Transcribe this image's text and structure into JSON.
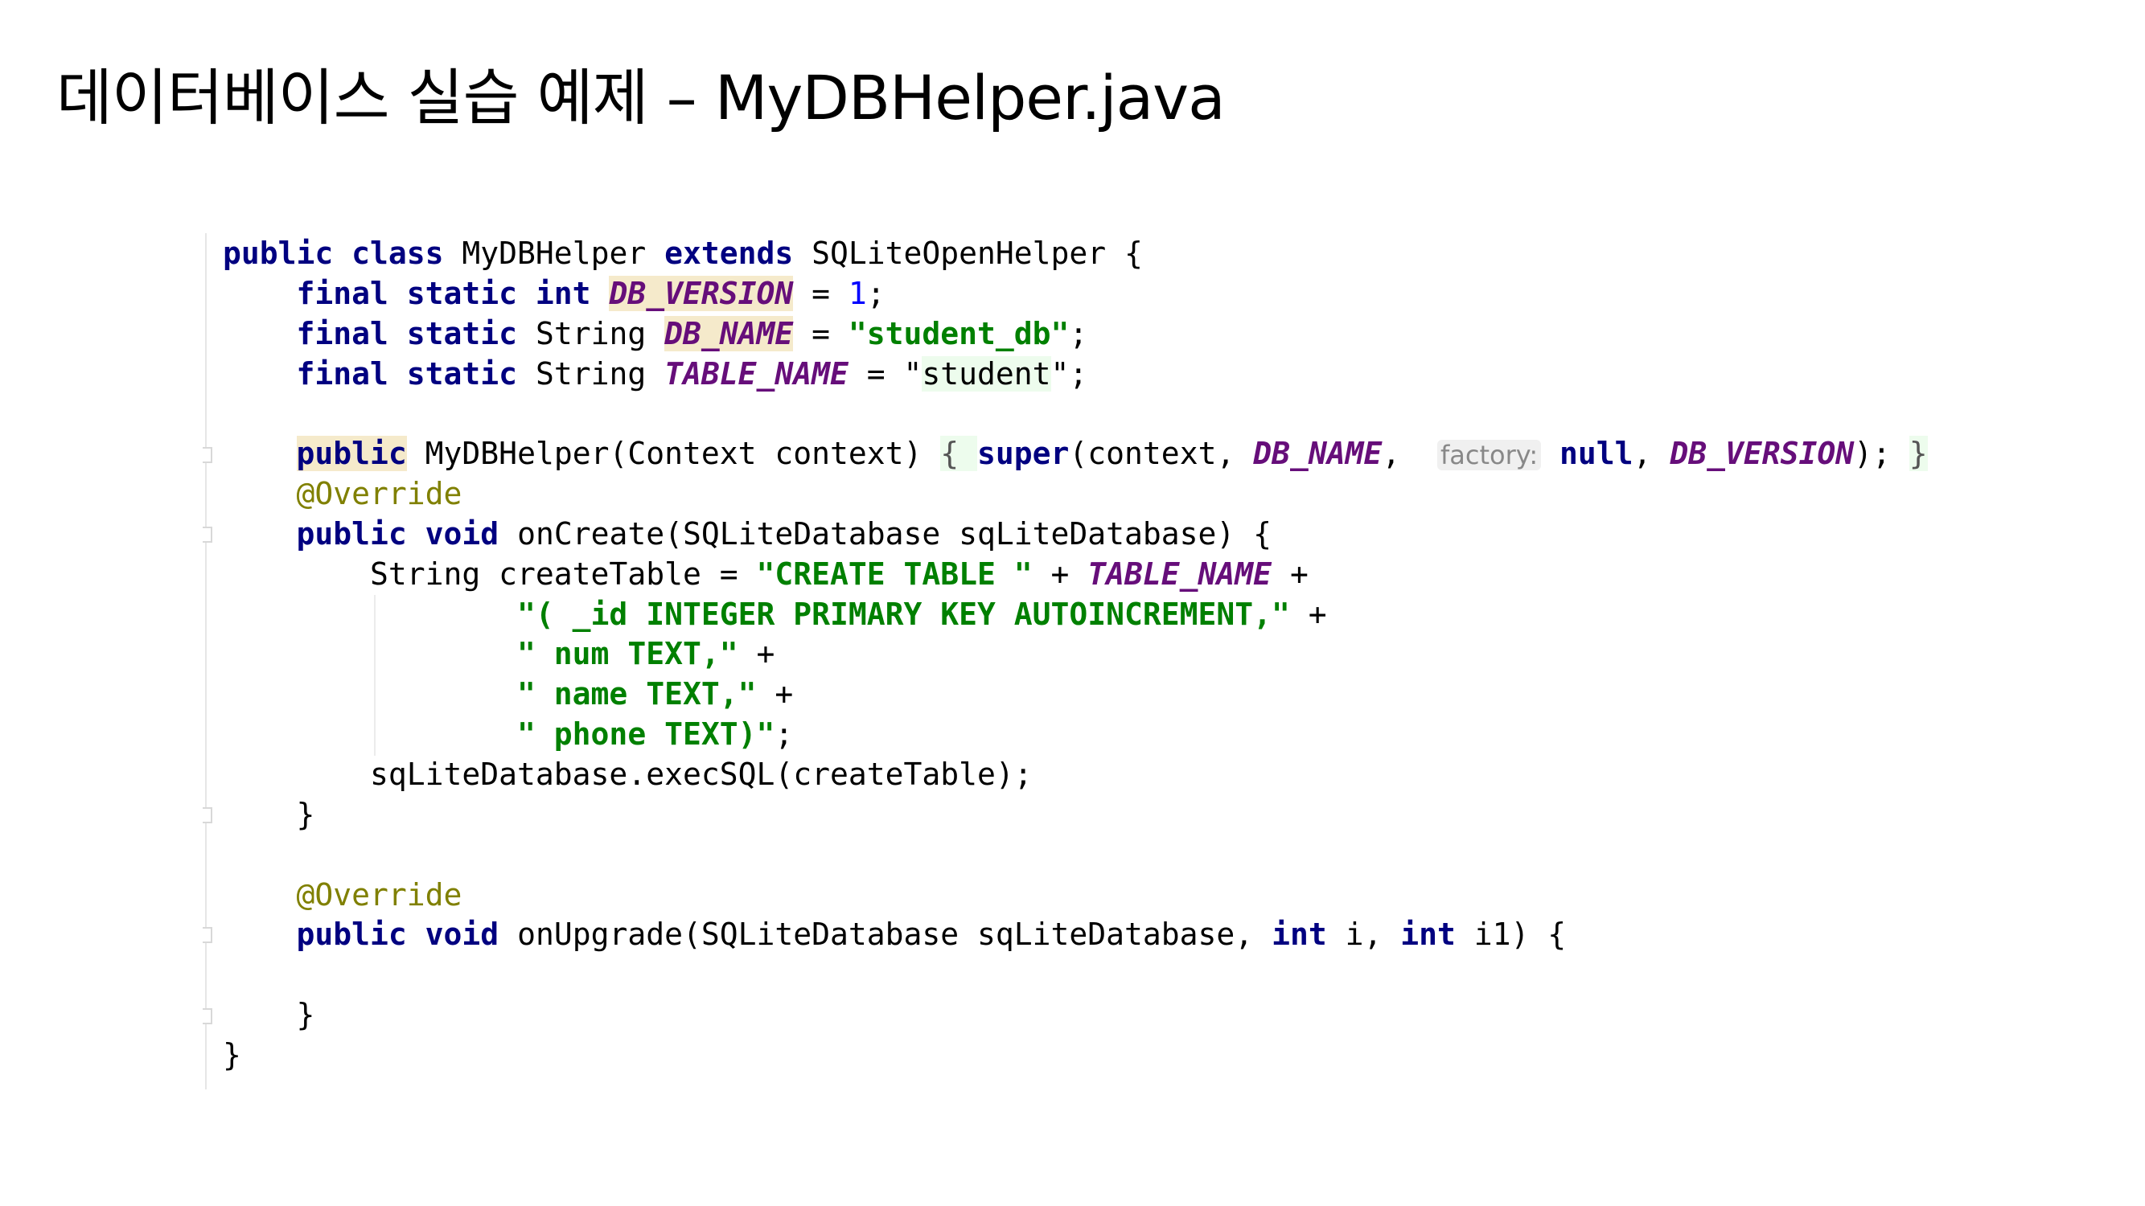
{
  "slide": {
    "title": "데이터베이스 실습 예제 – MyDBHelper.java"
  },
  "colors": {
    "keyword": "#000080",
    "constant": "#660E7A",
    "string": "#008000",
    "number": "#0000FF",
    "annotation": "#808000",
    "highlight_usage": "#F5EACB",
    "highlight_match": "#EDFCED"
  },
  "code": {
    "lines": [
      [
        {
          "t": "public class ",
          "c": "kw"
        },
        {
          "t": "MyDBHelper "
        },
        {
          "t": "extends ",
          "c": "kw"
        },
        {
          "t": "SQLiteOpenHelper {"
        }
      ],
      [
        {
          "t": "    "
        },
        {
          "t": "final static int ",
          "c": "kw"
        },
        {
          "t": "DB_VERSION",
          "c": "const hl-y"
        },
        {
          "t": " = "
        },
        {
          "t": "1",
          "c": "num"
        },
        {
          "t": ";"
        }
      ],
      [
        {
          "t": "    "
        },
        {
          "t": "final static ",
          "c": "kw"
        },
        {
          "t": "String "
        },
        {
          "t": "DB_NAME",
          "c": "const hl-y"
        },
        {
          "t": " = "
        },
        {
          "t": "\"student_db\"",
          "c": "str"
        },
        {
          "t": ";"
        }
      ],
      [
        {
          "t": "    "
        },
        {
          "t": "final static ",
          "c": "kw"
        },
        {
          "t": "String "
        },
        {
          "t": "TABLE_NAME",
          "c": "const"
        },
        {
          "t": " = \""
        },
        {
          "t": "student",
          "c": "hl-g"
        },
        {
          "t": "\";"
        }
      ],
      [],
      [
        {
          "t": "    "
        },
        {
          "t": "public",
          "c": "kw hl-y"
        },
        {
          "t": " MyDBHelper(Context context) "
        },
        {
          "t": "{ ",
          "c": "brace hl-g"
        },
        {
          "t": "super",
          "c": "kw"
        },
        {
          "t": "(context, "
        },
        {
          "t": "DB_NAME",
          "c": "const"
        },
        {
          "t": ",  "
        },
        {
          "t": "factory:",
          "c": "hint"
        },
        {
          "t": " "
        },
        {
          "t": "null",
          "c": "kw"
        },
        {
          "t": ", "
        },
        {
          "t": "DB_VERSION",
          "c": "const"
        },
        {
          "t": "); "
        },
        {
          "t": "}",
          "c": "brace hl-g"
        }
      ],
      [
        {
          "t": "    "
        },
        {
          "t": "@Override",
          "c": "ann"
        }
      ],
      [
        {
          "t": "    "
        },
        {
          "t": "public void ",
          "c": "kw"
        },
        {
          "t": "onCreate(SQLiteDatabase sqLiteDatabase) {"
        }
      ],
      [
        {
          "t": "        String createTable = "
        },
        {
          "t": "\"CREATE TABLE \"",
          "c": "str"
        },
        {
          "t": " + "
        },
        {
          "t": "TABLE_NAME",
          "c": "const"
        },
        {
          "t": " +"
        }
      ],
      [
        {
          "t": "                "
        },
        {
          "t": "\"( _id INTEGER PRIMARY KEY AUTOINCREMENT,\"",
          "c": "str"
        },
        {
          "t": " +"
        }
      ],
      [
        {
          "t": "                "
        },
        {
          "t": "\" num TEXT,\"",
          "c": "str"
        },
        {
          "t": " +"
        }
      ],
      [
        {
          "t": "                "
        },
        {
          "t": "\" name TEXT,\"",
          "c": "str"
        },
        {
          "t": " +"
        }
      ],
      [
        {
          "t": "                "
        },
        {
          "t": "\" phone TEXT)\"",
          "c": "str"
        },
        {
          "t": ";"
        }
      ],
      [
        {
          "t": "        sqLiteDatabase.execSQL(createTable);"
        }
      ],
      [
        {
          "t": "    }"
        }
      ],
      [],
      [
        {
          "t": "    "
        },
        {
          "t": "@Override",
          "c": "ann"
        }
      ],
      [
        {
          "t": "    "
        },
        {
          "t": "public void ",
          "c": "kw"
        },
        {
          "t": "onUpgrade(SQLiteDatabase sqLiteDatabase, "
        },
        {
          "t": "int ",
          "c": "kw"
        },
        {
          "t": "i, "
        },
        {
          "t": "int ",
          "c": "kw"
        },
        {
          "t": "i1) {"
        }
      ],
      [],
      [
        {
          "t": "    }"
        }
      ],
      [
        {
          "t": "}"
        }
      ]
    ]
  }
}
